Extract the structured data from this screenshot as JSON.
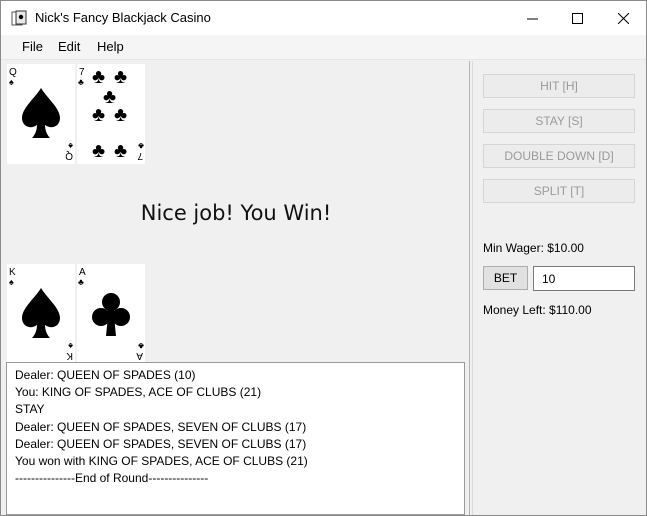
{
  "window": {
    "title": "Nick's Fancy Blackjack Casino"
  },
  "menu": [
    {
      "label": "File"
    },
    {
      "label": "Edit"
    },
    {
      "label": "Help"
    }
  ],
  "dealer_cards": [
    {
      "rank": "Q",
      "suit": "spades"
    },
    {
      "rank": "7",
      "suit": "clubs"
    }
  ],
  "player_cards": [
    {
      "rank": "K",
      "suit": "spades"
    },
    {
      "rank": "A",
      "suit": "clubs"
    }
  ],
  "result_message": "Nice job! You Win!",
  "actions": {
    "hit": "HIT [H]",
    "stay": "STAY [S]",
    "double_down": "DOUBLE DOWN [D]",
    "split": "SPLIT [T]"
  },
  "wager": {
    "min_wager": "Min Wager: $10.00",
    "bet_label": "BET",
    "bet_value": "10",
    "money_left": "Money Left: $110.00"
  },
  "log": [
    "Dealer: QUEEN OF SPADES (10)",
    "You: KING OF SPADES, ACE OF CLUBS (21)",
    "STAY",
    "Dealer: QUEEN OF SPADES, SEVEN OF CLUBS (17)",
    "Dealer: QUEEN OF SPADES, SEVEN OF CLUBS (17)",
    "You won with KING OF SPADES, ACE OF CLUBS (21)",
    "---------------End of Round---------------"
  ]
}
